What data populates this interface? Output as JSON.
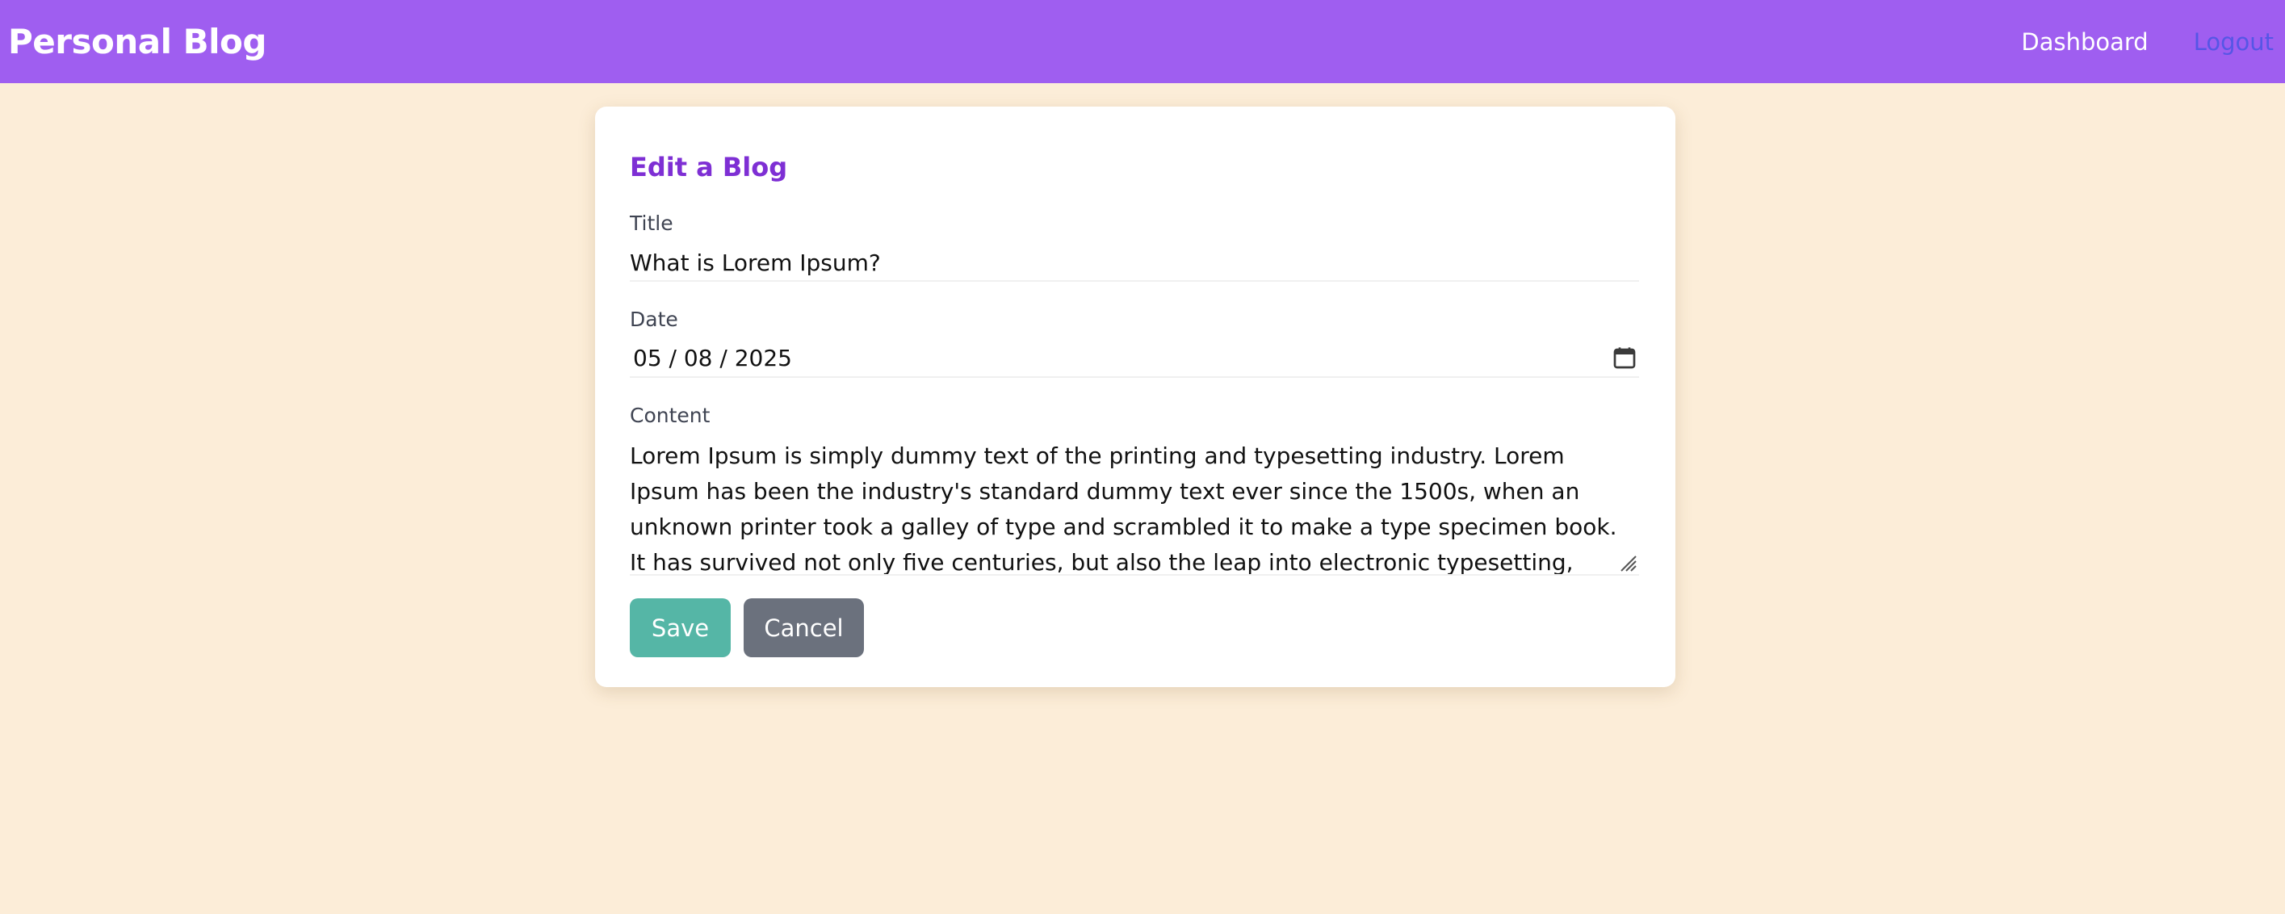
{
  "navbar": {
    "brand": "Personal Blog",
    "links": {
      "dashboard": "Dashboard",
      "logout": "Logout"
    }
  },
  "form": {
    "heading": "Edit a Blog",
    "title_label": "Title",
    "title_value": "What is Lorem Ipsum?",
    "date_label": "Date",
    "date_value": "05 / 08 / 2025",
    "date_icon": "calendar-icon",
    "content_label": "Content",
    "content_value": "Lorem Ipsum is simply dummy text of the printing and typesetting industry. Lorem Ipsum has been the industry's standard dummy text ever since the 1500s, when an unknown printer took a galley of type and scrambled it to make a type specimen book. It has survived not only five centuries, but also the leap into electronic typesetting, remaining essentially unchanged.",
    "buttons": {
      "save": "Save",
      "cancel": "Cancel"
    }
  },
  "colors": {
    "page_bg": "#fcedd8",
    "navbar_bg": "#9f5ef0",
    "heading": "#7e2fd4",
    "logout_link": "#5656e6",
    "save_bg": "#55b6a6",
    "cancel_bg": "#6b717d"
  }
}
